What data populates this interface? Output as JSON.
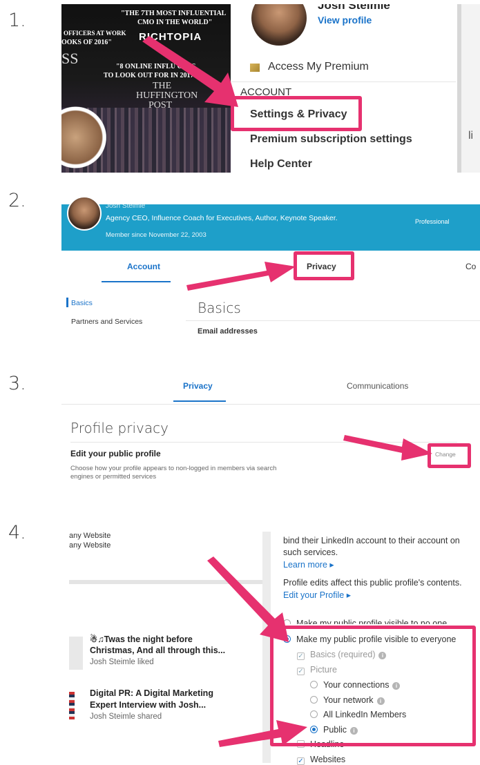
{
  "steps": {
    "one": "1.",
    "two": "2.",
    "three": "3.",
    "four": "4."
  },
  "panel1": {
    "photo_captions": {
      "quote1_line1": "\"THE 7TH MOST INFLUENTIAL",
      "quote1_line2": "CMO IN THE WORLD\"",
      "richtopia": "RICHTOPIA",
      "officers_at_work": "OFFICERS AT WORK",
      "books_2016": "OOKS OF 2016\"",
      "ss": "SS",
      "quote2_line1": "\"8 ONLINE INFLU   CERS",
      "quote2_line2": "TO LOOK OUT FOR IN 2017\"",
      "huffington1": "THE",
      "huffington2": "HUFFINGTON",
      "huffington3": "POST"
    },
    "user_name": "Josh Steimle",
    "view_profile": "View profile",
    "access_premium": "Access My Premium",
    "account_header": "ACCOUNT",
    "settings_privacy": "Settings & Privacy",
    "premium_settings": "Premium subscription settings",
    "help_center": "Help Center",
    "side_text": "li"
  },
  "panel2": {
    "name": "Josh Steimle",
    "headline": "Agency CEO, Influence Coach for Executives, Author, Keynote Speaker.",
    "member_since": "Member since November 22, 2003",
    "plan": "Professional",
    "tabs": {
      "account": "Account",
      "privacy": "Privacy",
      "communications": "Co"
    },
    "sidebar": {
      "basics": "Basics",
      "partners": "Partners and Services"
    },
    "section_title": "Basics",
    "email_label": "Email addresses"
  },
  "panel3": {
    "tabs": {
      "privacy": "Privacy",
      "communications": "Communications"
    },
    "title": "Profile privacy",
    "item_title": "Edit your public profile",
    "item_desc_line1": "Choose how your profile appears to non-logged in members via search",
    "item_desc_line2": "engines or permitted services",
    "change_button": "Change"
  },
  "panel4": {
    "left": {
      "company1": "any Website",
      "company2": "any Website",
      "post1_title_line1": "Twas the night before",
      "post1_title_line2": "Christmas, And all through this...",
      "post1_meta": "Josh Steimle liked",
      "post2_title_line1": "Digital PR: A Digital Marketing",
      "post2_title_line2": "Expert Interview with Josh...",
      "post2_meta": "Josh Steimle shared"
    },
    "right": {
      "intro_line1": "bind their LinkedIn account to their account on",
      "intro_line2": "such services.",
      "learn_more": "Learn more ▸",
      "edits_note": "Profile edits affect this public profile's contents.",
      "edit_profile": "Edit your Profile ▸",
      "option_none": "Make my public profile visible to no one",
      "option_everyone": "Make my public profile visible to everyone",
      "basics": "Basics (required)",
      "picture": "Picture",
      "your_connections": "Your connections",
      "your_network": "Your network",
      "all_members": "All LinkedIn Members",
      "public": "Public",
      "headline": "Headline",
      "websites": "Websites"
    }
  },
  "colors": {
    "highlight": "#e6316f",
    "linkedin_blue": "#1e9fc9",
    "link": "#1a73c9"
  }
}
